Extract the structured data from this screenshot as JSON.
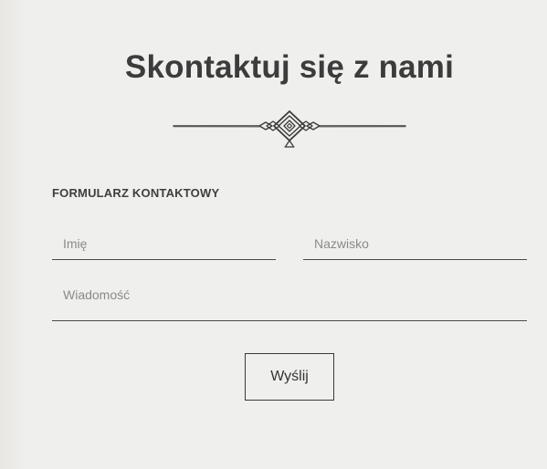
{
  "page": {
    "title": "Skontaktuj się z nami"
  },
  "form": {
    "heading": "FORMULARZ KONTAKTOWY",
    "first_name_placeholder": "Imię",
    "last_name_placeholder": "Nazwisko",
    "message_placeholder": "Wiadomość",
    "submit_label": "Wyślij"
  },
  "colors": {
    "background": "#efefed",
    "text": "#3c3c3c",
    "line": "#4a4a4a"
  }
}
